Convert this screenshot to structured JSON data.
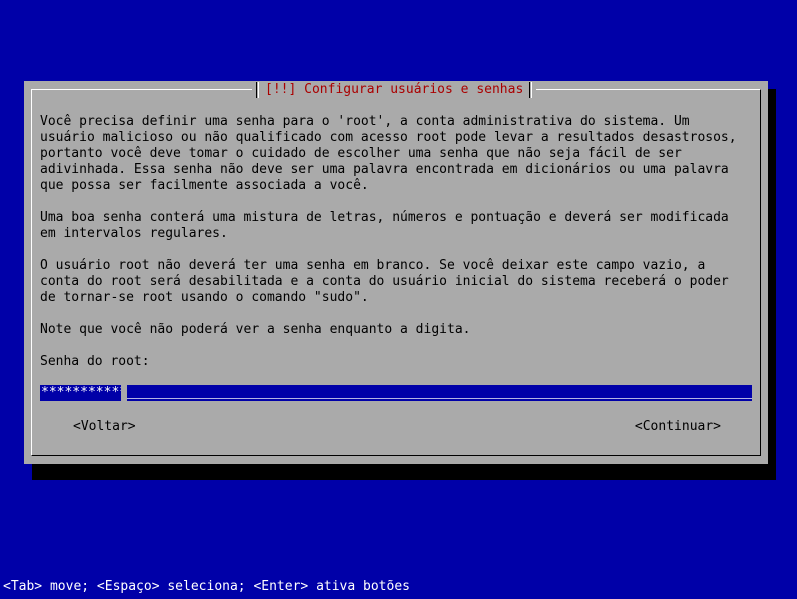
{
  "dialog": {
    "title": "[!!] Configurar usuários e senhas",
    "paragraphs": [
      "Você precisa definir uma senha para o 'root', a conta administrativa do sistema. Um\nusuário malicioso ou não qualificado com acesso root pode levar a resultados desastrosos,\nportanto você deve tomar o cuidado de escolher uma senha que não seja fácil de ser\nadivinhada. Essa senha não deve ser uma palavra encontrada em dicionários ou uma palavra\nque possa ser facilmente associada a você.",
      "Uma boa senha conterá uma mistura de letras, números e pontuação e deverá ser modificada\nem intervalos regulares.",
      "O usuário root não deverá ter uma senha em branco. Se você deixar este campo vazio, a\nconta do root será desabilitada e a conta do usuário inicial do sistema receberá o poder\nde tornar-se root usando o comando \"sudo\".",
      "Note que você não poderá ver a senha enquanto a digita."
    ],
    "prompt_label": "Senha do root:",
    "password_value": "***********",
    "buttons": {
      "back": "<Voltar>",
      "continue": "<Continuar>"
    }
  },
  "status_bar": "<Tab> move; <Espaço> seleciona; <Enter> ativa botões",
  "colors": {
    "background": "#0000a8",
    "dialog": "#aaaaaa",
    "title_text": "#aa0000",
    "shadow": "#000000",
    "text": "#000000",
    "status_text": "#ffffff",
    "field_fill": "#0000a8"
  }
}
